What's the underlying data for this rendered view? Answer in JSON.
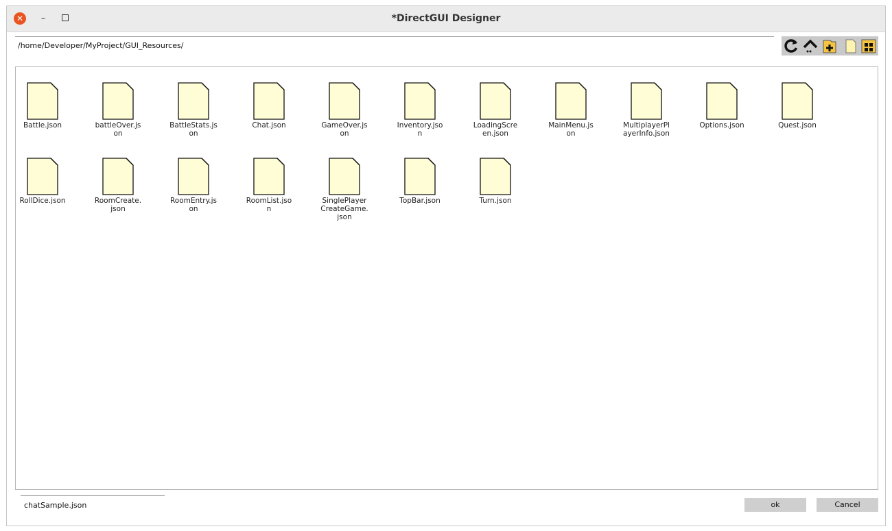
{
  "window": {
    "title": "*DirectGUI Designer",
    "close_glyph": "✕",
    "minimize_glyph": "–"
  },
  "path": {
    "value": "/home/Developer/MyProject/GUI_Resources/"
  },
  "toolbar": {
    "buttons": [
      "refresh-icon",
      "parent-folder-icon",
      "new-folder-icon",
      "file-view-icon",
      "grid-view-icon"
    ]
  },
  "files": [
    "Battle.json",
    "battleOver.json",
    "BattleStats.json",
    "Chat.json",
    "GameOver.json",
    "Inventory.json",
    "LoadingScreen.json",
    "MainMenu.json",
    "MultiplayerPlayerInfo.json",
    "Options.json",
    "Quest.json",
    "RollDice.json",
    "RoomCreate.json",
    "RoomEntry.json",
    "RoomList.json",
    "SinglePlayerCreateGame.json",
    "TopBar.json",
    "Turn.json"
  ],
  "footer": {
    "filename": "chatSample.json",
    "ok_label": "ok",
    "cancel_label": "Cancel"
  },
  "colors": {
    "file_icon_fill": "#fffdd5",
    "close_button": "#e95420",
    "toolbar_bg": "#c9c9c9",
    "folder_icon": "#f5c542"
  }
}
